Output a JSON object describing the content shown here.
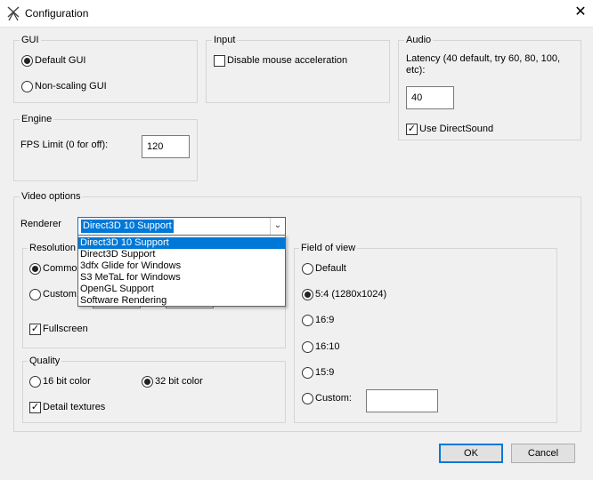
{
  "window": {
    "title": "Configuration",
    "close_glyph": "✕",
    "icon": "windmill-icon"
  },
  "gui": {
    "legend": "GUI",
    "default_label": "Default GUI",
    "default_selected": true,
    "nonscaling_label": "Non-scaling GUI",
    "nonscaling_selected": false
  },
  "input": {
    "legend": "Input",
    "mouse_accel_label": "Disable mouse acceleration",
    "mouse_accel_checked": false
  },
  "audio": {
    "legend": "Audio",
    "latency_label": "Latency (40 default, try 60, 80, 100, etc):",
    "latency_value": "40",
    "directsound_label": "Use DirectSound",
    "directsound_checked": true
  },
  "engine": {
    "legend": "Engine",
    "fps_label": "FPS Limit (0 for off):",
    "fps_value": "120"
  },
  "video": {
    "legend": "Video options",
    "renderer_label": "Renderer",
    "renderer_selected": "Direct3D 10 Support",
    "renderer_options": [
      "Direct3D 10 Support",
      "Direct3D Support",
      "3dfx Glide for Windows",
      "S3 MeTaL for Windows",
      "OpenGL Support",
      "Software Rendering"
    ],
    "resolution": {
      "legend": "Resolution",
      "common_label": "Common",
      "common_selected": true,
      "custom_label": "Custom:",
      "custom_selected": false,
      "fullscreen_label": "Fullscreen",
      "fullscreen_checked": true
    },
    "quality": {
      "legend": "Quality",
      "bit16_label": "16 bit color",
      "bit16_selected": false,
      "bit32_label": "32 bit color",
      "bit32_selected": true,
      "detail_label": "Detail textures",
      "detail_checked": true
    },
    "fov": {
      "legend": "Field of view",
      "options": [
        {
          "label": "Default",
          "selected": false
        },
        {
          "label": "5:4 (1280x1024)",
          "selected": true
        },
        {
          "label": "16:9",
          "selected": false
        },
        {
          "label": "16:10",
          "selected": false
        },
        {
          "label": "15:9",
          "selected": false
        },
        {
          "label": "Custom:",
          "selected": false
        }
      ],
      "custom_value": ""
    }
  },
  "buttons": {
    "ok": "OK",
    "cancel": "Cancel"
  },
  "colors": {
    "accent": "#0078d7",
    "dialog_bg": "#f0f0f0"
  }
}
